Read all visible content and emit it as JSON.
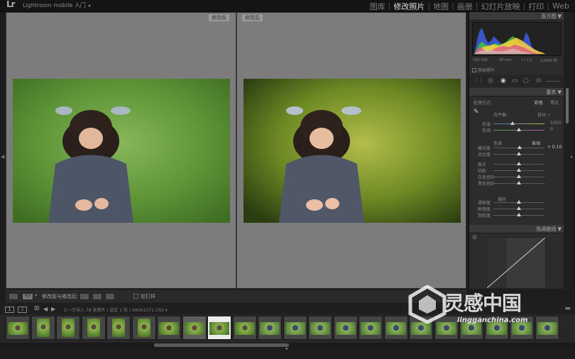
{
  "app": {
    "logo": "Lr",
    "title": "Lightroom mobile 入门",
    "title_arrow": "▸"
  },
  "modules": [
    {
      "label": "图库",
      "active": false
    },
    {
      "label": "修改照片",
      "active": true
    },
    {
      "label": "地图",
      "active": false
    },
    {
      "label": "画册",
      "active": false
    },
    {
      "label": "幻灯片放映",
      "active": false
    },
    {
      "label": "打印",
      "active": false
    },
    {
      "label": "Web",
      "active": false
    }
  ],
  "compare": {
    "before_label": "修改前",
    "after_label": "修改后"
  },
  "toolbar": {
    "view_mode": "Y|Y",
    "label": "修改前与修改后:",
    "softproof_label": "软打样"
  },
  "panel": {
    "histogram_header": "直方图 ▼",
    "histogram_info": [
      "ISO 100",
      "35 mm",
      "f / 1.2",
      "1/1600 秒"
    ],
    "original_photo_label": "原始照片",
    "basic_header": "基本 ▼",
    "treatment_label": "处理方式:",
    "treatment_color": "彩色",
    "treatment_bw": "黑白",
    "wb_label": "白平衡:",
    "wb_value": "自动 ÷",
    "temp_label": "色温",
    "temp_value": "5500",
    "tint_label": "色调",
    "tint_value": "0",
    "tone_label": "色调",
    "tone_auto": "自动",
    "exposure_value": "+ 0.10",
    "curve_header": "色调曲线 ▼",
    "sliders": [
      {
        "label": "曝光度",
        "level": 0.52
      },
      {
        "label": "对比度",
        "level": 0.5
      },
      {
        "label": "高光",
        "level": 0.5
      },
      {
        "label": "阴影",
        "level": 0.5
      },
      {
        "label": "白色色阶",
        "level": 0.5
      },
      {
        "label": "黑色色阶",
        "level": 0.5
      },
      {
        "label": "清晰度",
        "level": 0.5
      },
      {
        "label": "鲜艳度",
        "level": 0.5
      },
      {
        "label": "饱和度",
        "level": 0.5
      }
    ],
    "presence_label": "偏好"
  },
  "filmstrip_header": {
    "page1": "1",
    "page2": "2",
    "text": "上一次导入  78 张照片 / 选定 1 张 / 4A0A1071.CR2 ▾"
  },
  "watermark": {
    "title": "灵感中国",
    "url": "lingganchina.com"
  },
  "colors": {
    "accent": "#e0e0e0",
    "panel": "#2c2c2c",
    "background": "#7c7c7c"
  }
}
